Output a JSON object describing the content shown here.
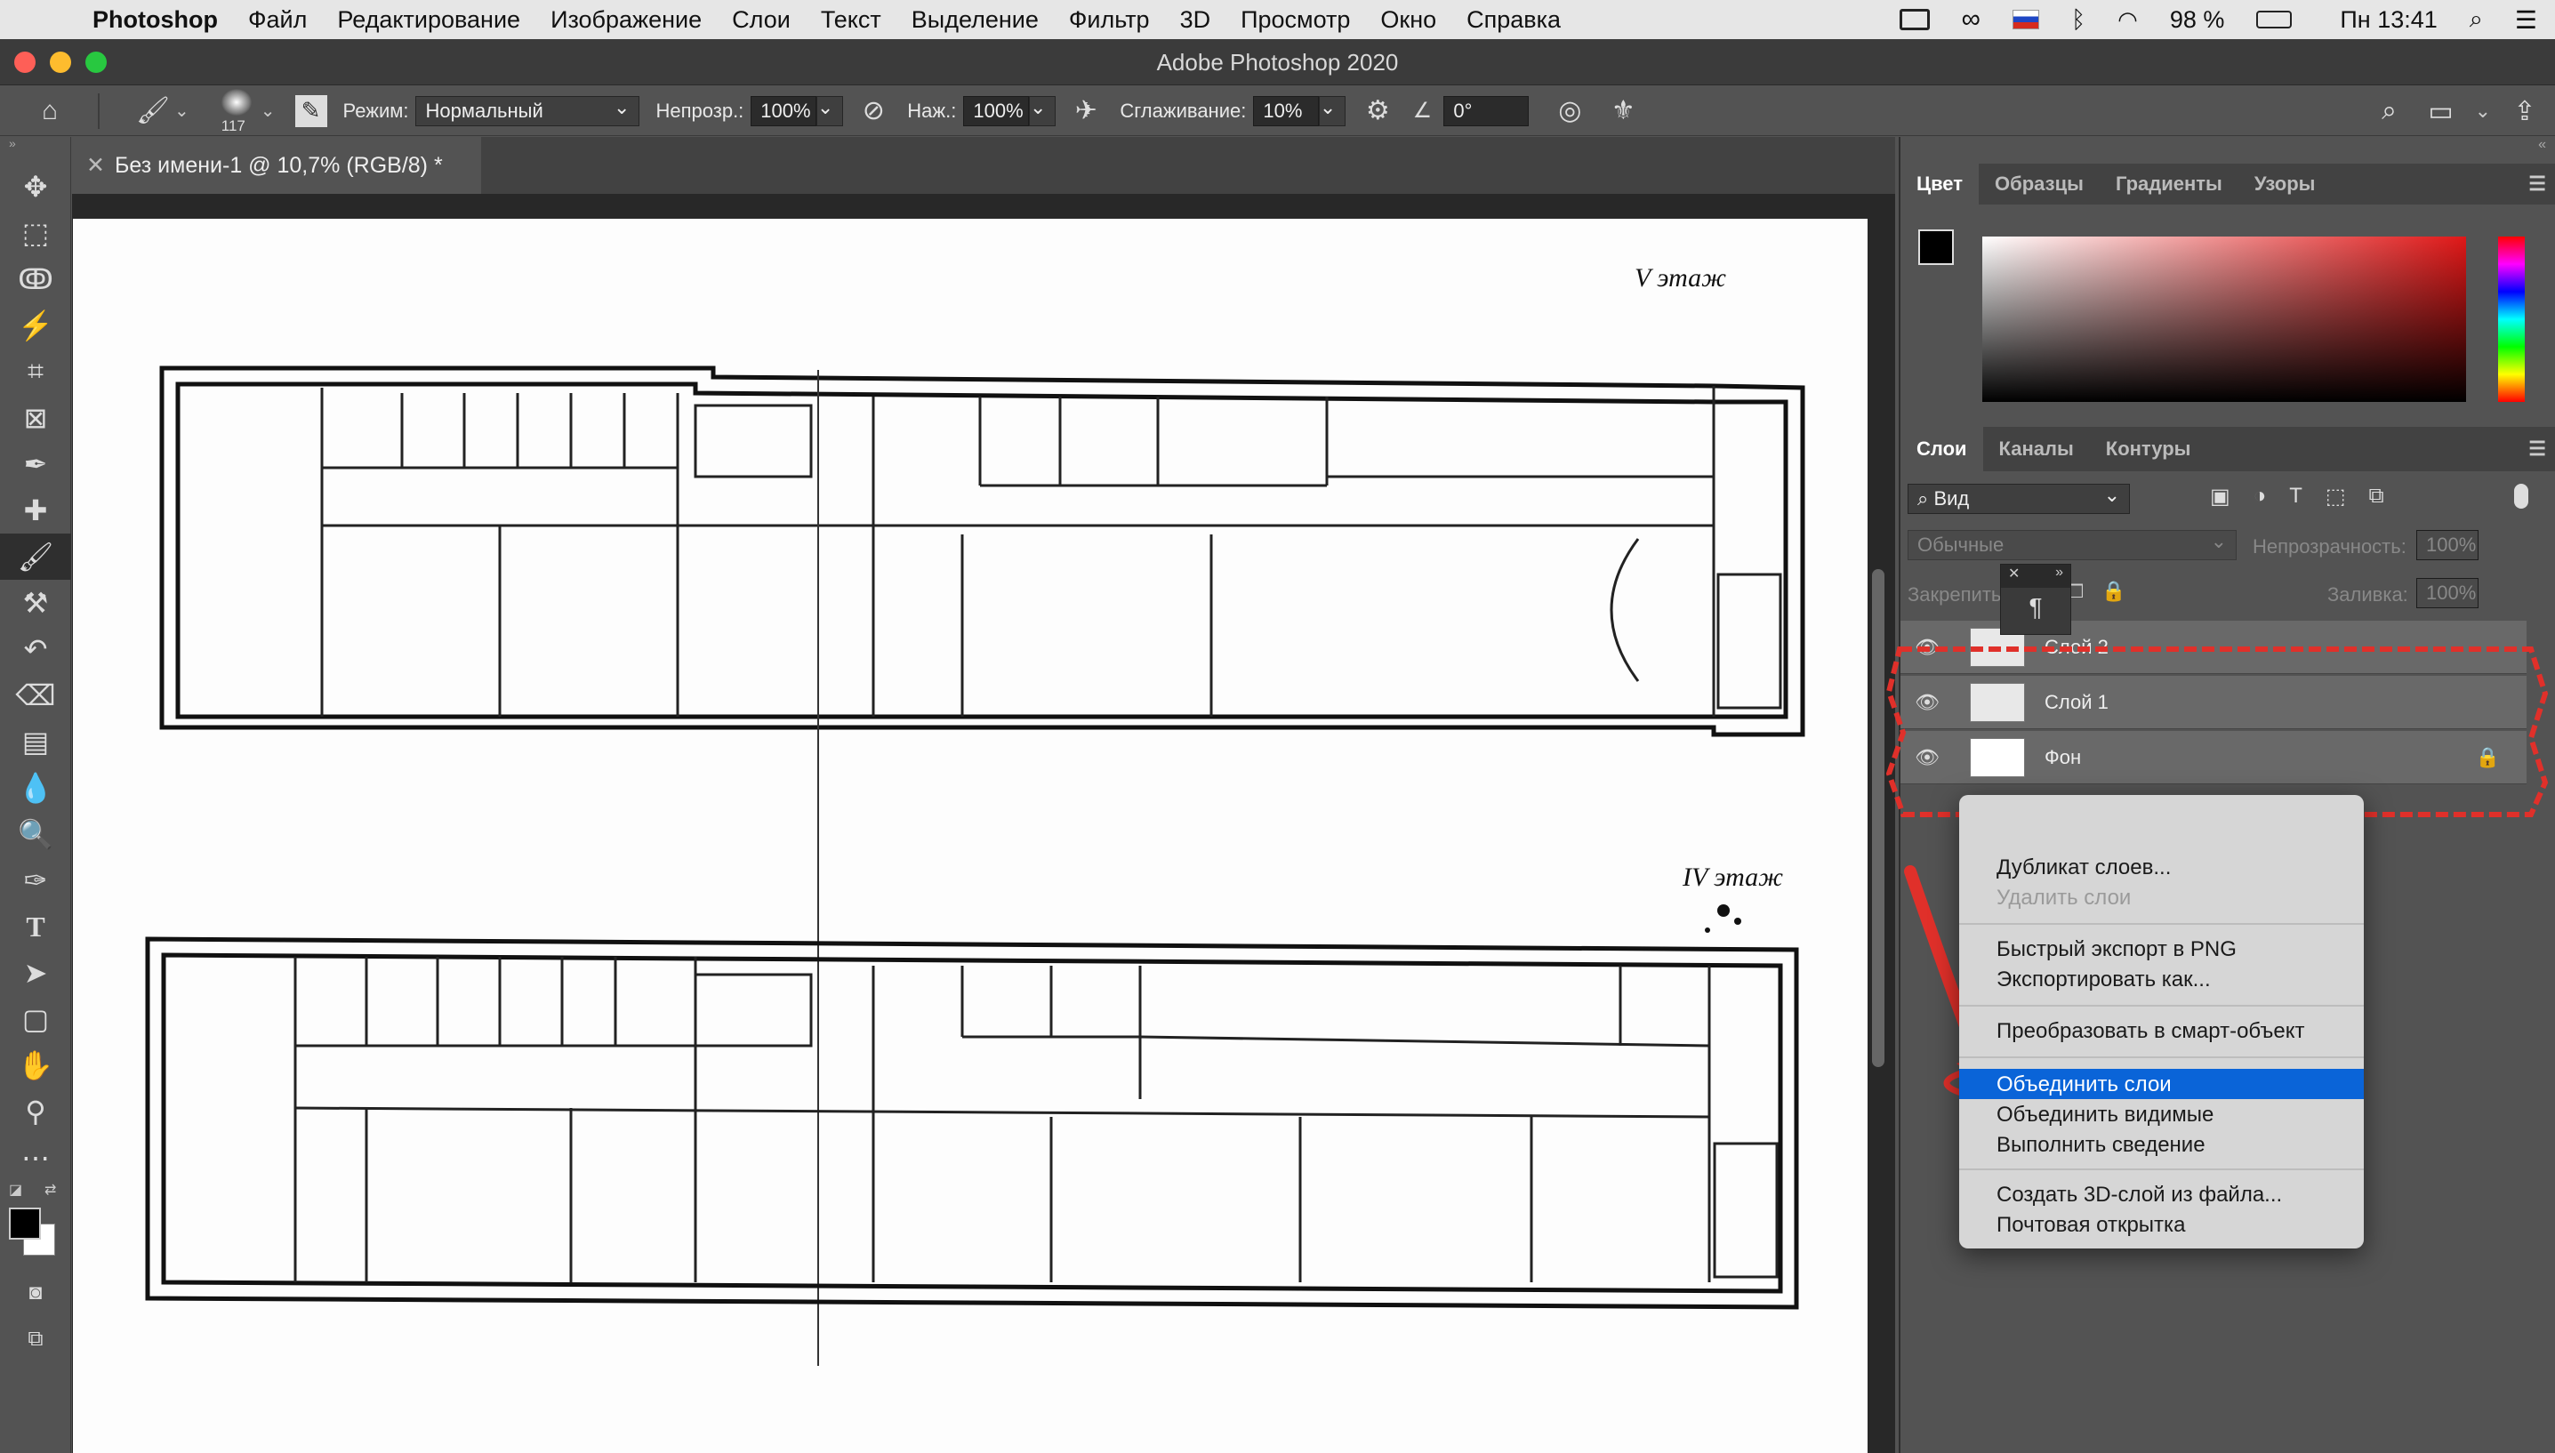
{
  "menubar": {
    "app": "Photoshop",
    "items": [
      "Файл",
      "Редактирование",
      "Изображение",
      "Слои",
      "Текст",
      "Выделение",
      "Фильтр",
      "3D",
      "Просмотр",
      "Окно",
      "Справка"
    ],
    "battery": "98 %",
    "clock": "Пн 13:41"
  },
  "window": {
    "title": "Adobe Photoshop 2020"
  },
  "options": {
    "brush_size": "117",
    "mode_label": "Режим:",
    "mode_value": "Нормальный",
    "opacity_label": "Непрозр.:",
    "opacity_value": "100%",
    "pressure_label": "Наж.:",
    "pressure_value": "100%",
    "smoothing_label": "Сглаживание:",
    "smoothing_value": "10%",
    "angle_value": "0°"
  },
  "document": {
    "tab_title": "Без имени-1 @ 10,7% (RGB/8) *",
    "floor_top": "V этаж",
    "floor_bottom": "IV этаж"
  },
  "color_panel": {
    "tabs": [
      "Цвет",
      "Образцы",
      "Градиенты",
      "Узоры"
    ]
  },
  "layers_panel": {
    "tabs": [
      "Слои",
      "Каналы",
      "Контуры"
    ],
    "filter_value": "Вид",
    "blend_value": "Обычные",
    "opacity_label": "Непрозрачность:",
    "opacity_value": "100%",
    "lock_label": "Закрепить:",
    "fill_label": "Заливка:",
    "fill_value": "100%",
    "layers": [
      {
        "name": "Слой 2"
      },
      {
        "name": "Слой 1"
      },
      {
        "name": "Фон"
      }
    ]
  },
  "context_menu": {
    "items": [
      "Дубликат слоев...",
      "Удалить слои",
      "Быстрый экспорт в PNG",
      "Экспортировать как...",
      "Преобразовать в смарт-объект",
      "Объединить слои",
      "Объединить видимые",
      "Выполнить сведение",
      "Создать 3D-слой из файла...",
      "Почтовая открытка"
    ]
  },
  "colors": {
    "highlight": "#0a64d8",
    "annotation": "#e0302a"
  }
}
